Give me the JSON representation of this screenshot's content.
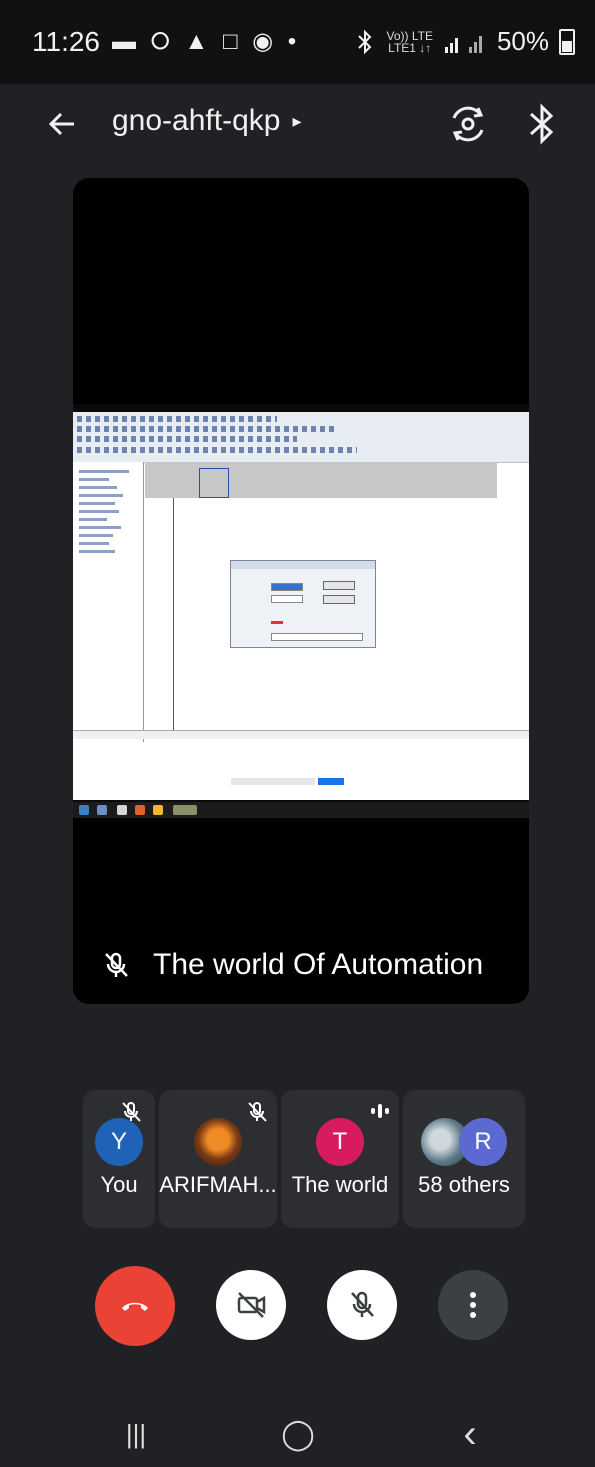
{
  "status_bar": {
    "time": "11:26",
    "notification_icons": "▬ ⭘ ▲ □ ◉ •",
    "network_small_top": "Vo)) LTE",
    "network_small_bottom": "LTE1 ↓↑",
    "battery": "50%"
  },
  "top_bar": {
    "back_icon": "arrow-left-icon",
    "meeting_code": "gno-ahft-qkp",
    "code_caret": "▸",
    "switch_camera_icon": "switch-camera-icon",
    "bluetooth_icon": "bluetooth-icon"
  },
  "main_tile": {
    "presenter_name": "The world Of Automation",
    "mic_state_icon": "mic-off-icon"
  },
  "participants": [
    {
      "initial": "Y",
      "name": "You",
      "avatar_color": "#1e63b8",
      "muted": true
    },
    {
      "initial": "",
      "name": "ARIFMAH...",
      "avatar_color": "#7a3a16",
      "muted": true
    },
    {
      "initial": "T",
      "name": "The world",
      "avatar_color": "#d81b60",
      "speaking": true
    },
    {
      "initial": "R",
      "name": "58 others",
      "avatar_color": "#5b6ad0"
    }
  ],
  "controls": {
    "end_call_icon": "end-call-icon",
    "camera_icon": "camera-off-icon",
    "mic_icon": "mic-off-icon",
    "more_icon": "more-vertical-icon"
  },
  "navbar": {
    "recents": "|||",
    "home": "◯",
    "back": "‹"
  },
  "colors": {
    "end_call": "#ea4335",
    "background": "#202124",
    "tile": "#2d2e31"
  }
}
